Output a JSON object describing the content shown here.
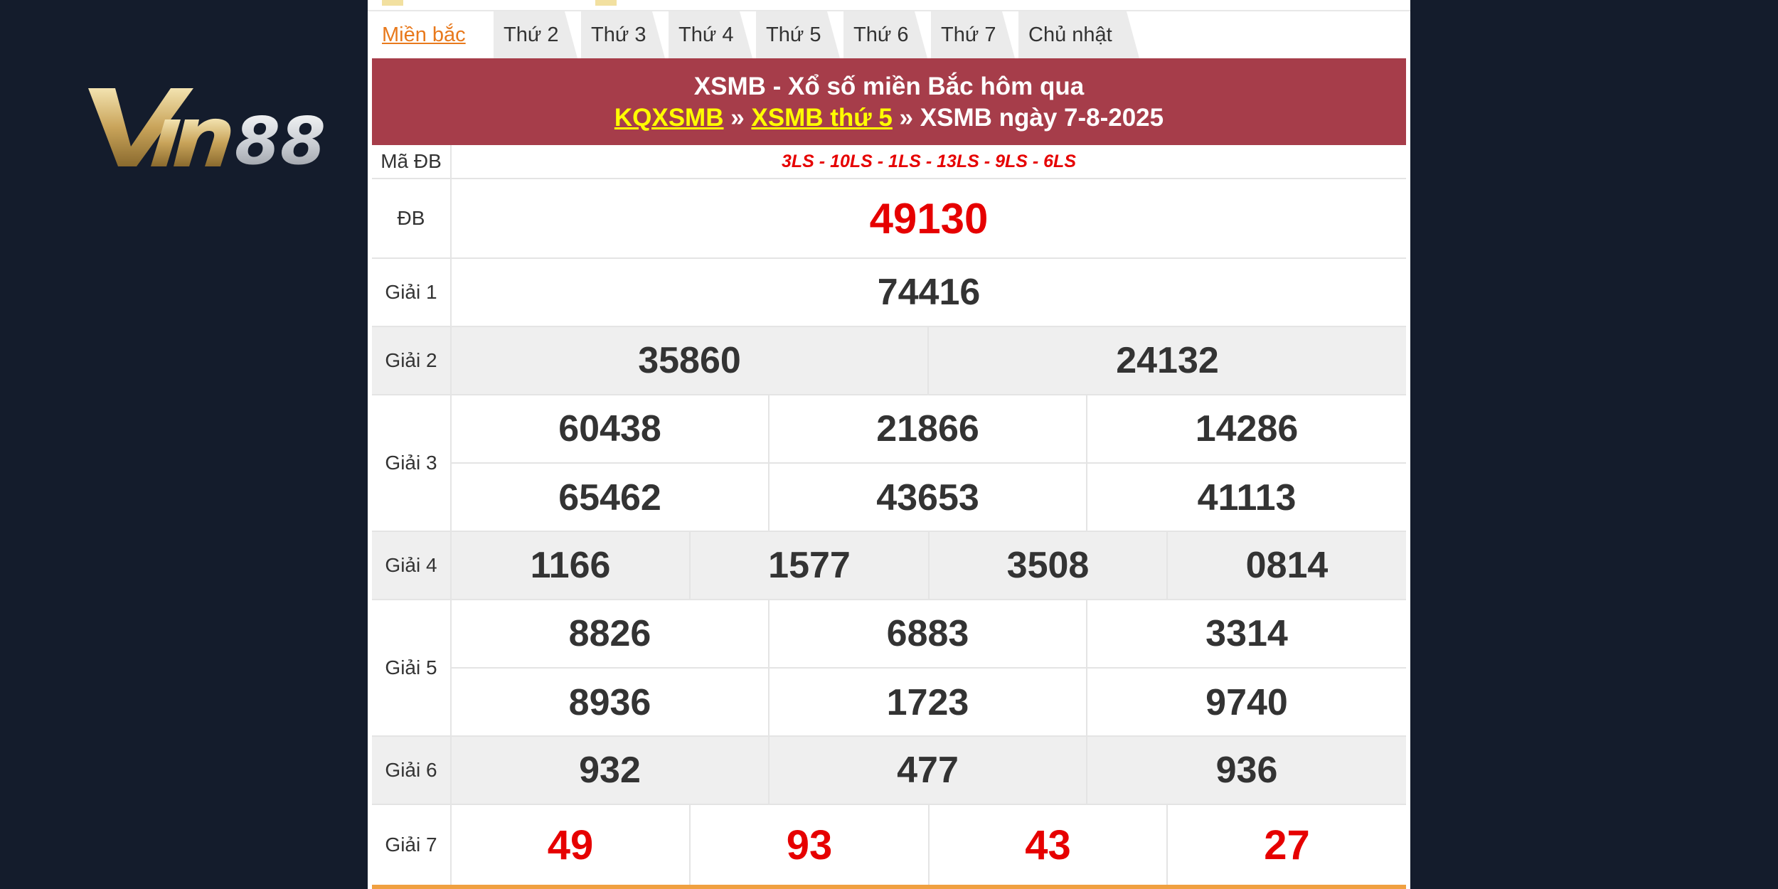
{
  "logo": {
    "text": "Vin88"
  },
  "tabs": [
    {
      "label": "Miền bắc",
      "active": true
    },
    {
      "label": "Thứ 2"
    },
    {
      "label": "Thứ 3"
    },
    {
      "label": "Thứ 4"
    },
    {
      "label": "Thứ 5"
    },
    {
      "label": "Thứ 6"
    },
    {
      "label": "Thứ 7"
    },
    {
      "label": "Chủ nhật"
    }
  ],
  "banner": {
    "title": "XSMB - Xổ số miền Bắc hôm qua",
    "link1": "KQXSMB",
    "sep1": " » ",
    "link2": "XSMB thứ 5",
    "sep2": " » ",
    "date_text": "XSMB ngày 7-8-2025"
  },
  "results": {
    "ma_db_label": "Mã ĐB",
    "ma_db_value": "3LS - 10LS - 1LS - 13LS - 9LS - 6LS",
    "db_label": "ĐB",
    "db": "49130",
    "g1_label": "Giải 1",
    "g1": "74416",
    "g2_label": "Giải 2",
    "g2": [
      "35860",
      "24132"
    ],
    "g3_label": "Giải 3",
    "g3": [
      "60438",
      "21866",
      "14286",
      "65462",
      "43653",
      "41113"
    ],
    "g4_label": "Giải 4",
    "g4": [
      "1166",
      "1577",
      "3508",
      "0814"
    ],
    "g5_label": "Giải 5",
    "g5": [
      "8826",
      "6883",
      "3314",
      "8936",
      "1723",
      "9740"
    ],
    "g6_label": "Giải 6",
    "g6": [
      "932",
      "477",
      "936"
    ],
    "g7_label": "Giải 7",
    "g7": [
      "49",
      "93",
      "43",
      "27"
    ]
  }
}
